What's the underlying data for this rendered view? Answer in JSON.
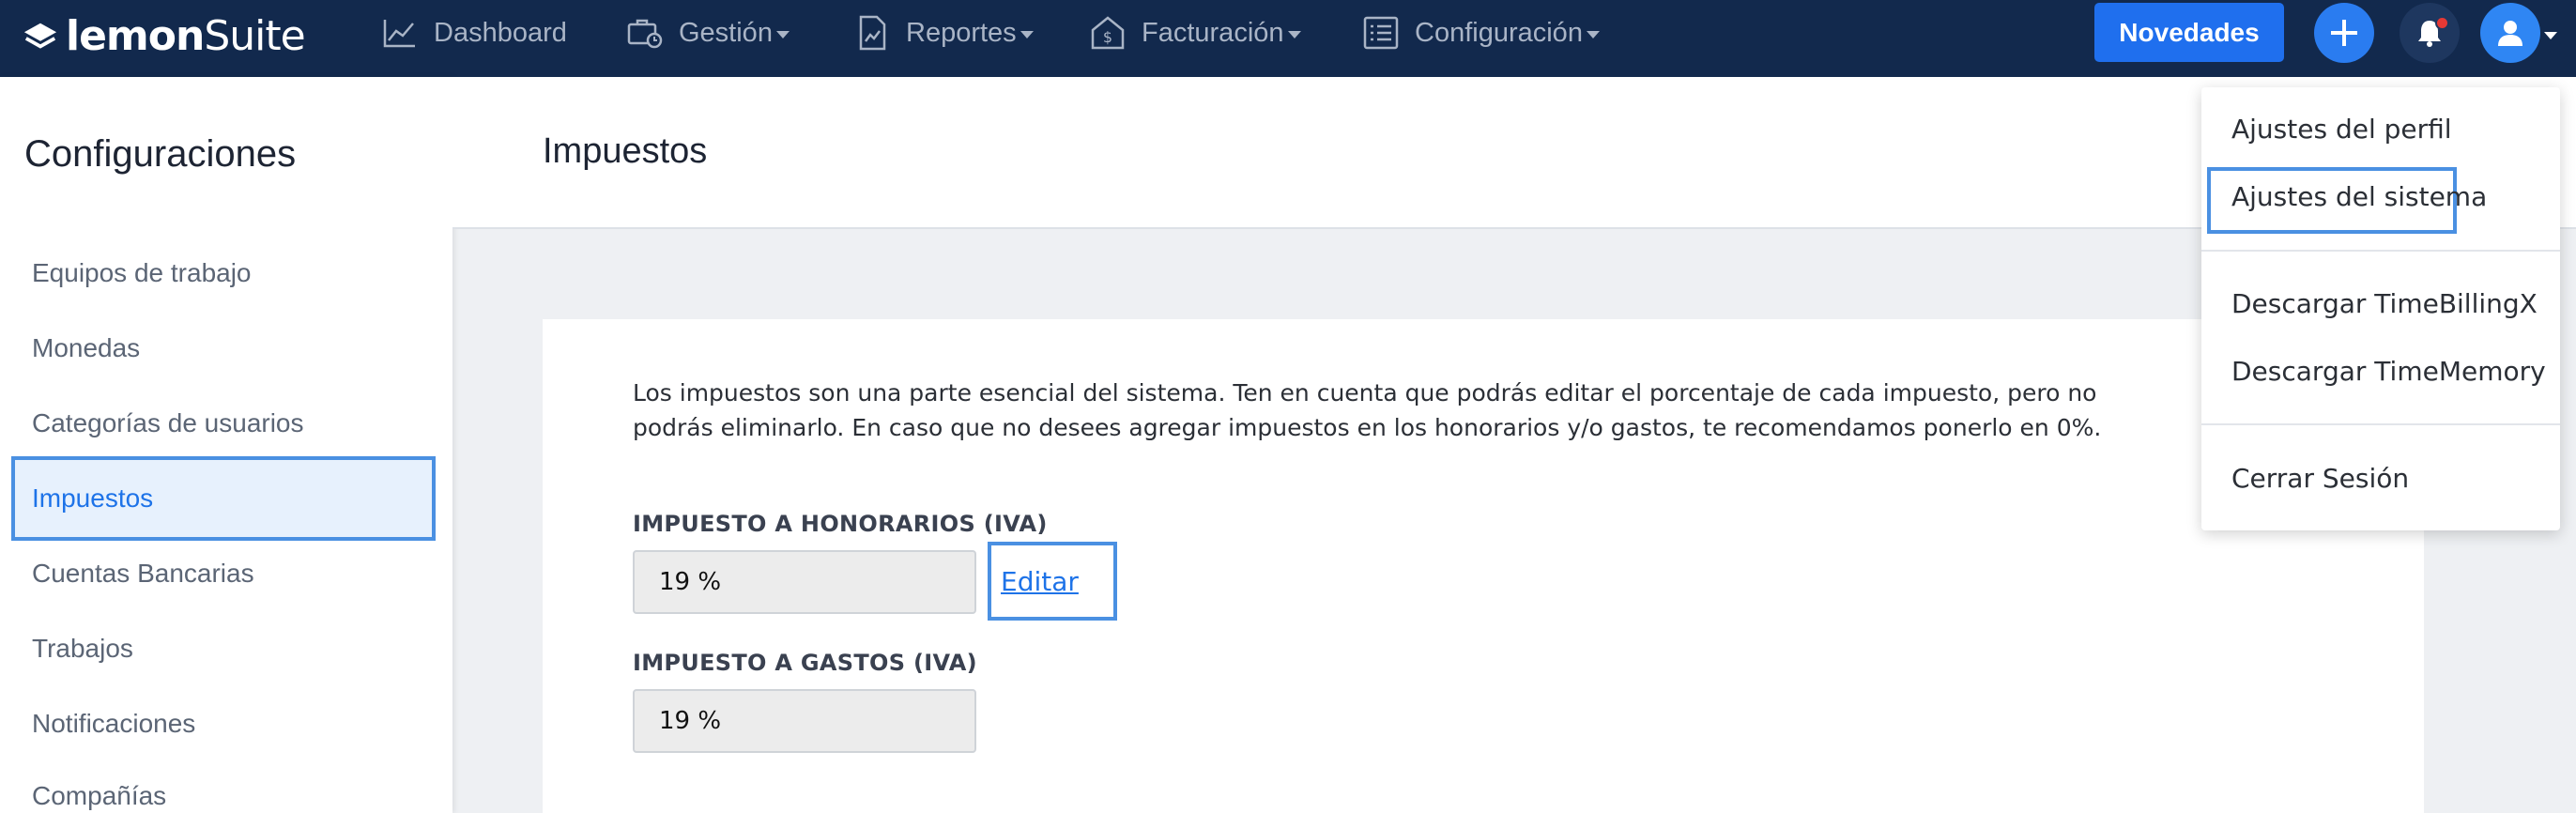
{
  "app": {
    "brand_bold": "lemon",
    "brand_light": "Suite"
  },
  "nav": {
    "dashboard": "Dashboard",
    "gestion": "Gestión",
    "reportes": "Reportes",
    "facturacion": "Facturación",
    "configuracion": "Configuración",
    "novedades": "Novedades"
  },
  "sidebar": {
    "title": "Configuraciones",
    "items": [
      {
        "label": "Equipos de trabajo"
      },
      {
        "label": "Monedas"
      },
      {
        "label": "Categorías de usuarios"
      },
      {
        "label": "Impuestos"
      },
      {
        "label": "Cuentas Bancarias"
      },
      {
        "label": "Trabajos"
      },
      {
        "label": "Notificaciones"
      },
      {
        "label": "Compañías"
      }
    ]
  },
  "page": {
    "title": "Impuestos",
    "description": "Los impuestos son una parte esencial del sistema. Ten en cuenta que podrás editar el porcentaje de cada impuesto, pero no podrás eliminarlo. En caso que no desees agregar impuestos en los honorarios y/o gastos, te recomendamos ponerlo en 0%.",
    "fee_tax_label": "IMPUESTO A HONORARIOS (IVA)",
    "fee_tax_value": "19 %",
    "edit_label": "Editar",
    "expense_tax_label": "IMPUESTO A GASTOS (IVA)",
    "expense_tax_value": "19 %"
  },
  "user_menu": {
    "profile_settings": "Ajustes del perfil",
    "system_settings": "Ajustes del sistema",
    "download_timebilling": "Descargar TimeBillingX",
    "download_timememory": "Descargar TimeMemory",
    "logout": "Cerrar Sesión"
  },
  "colors": {
    "topbar": "#12294d",
    "accent": "#1f6fee",
    "highlight": "#4a90e2"
  }
}
